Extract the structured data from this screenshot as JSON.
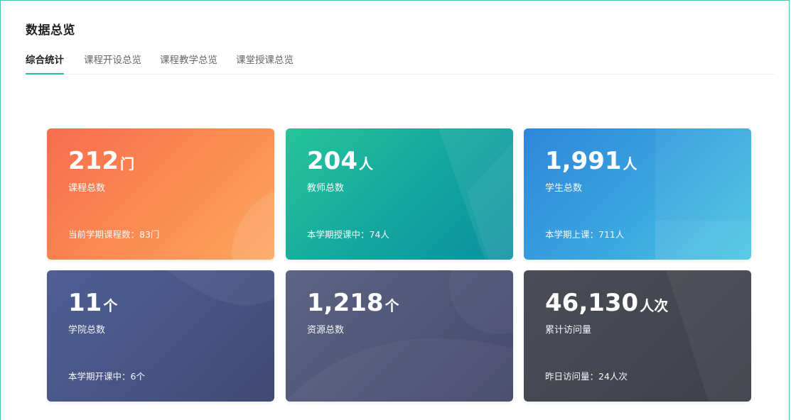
{
  "header": {
    "title": "数据总览"
  },
  "tabs": [
    {
      "label": "综合统计",
      "active": true
    },
    {
      "label": "课程开设总览",
      "active": false
    },
    {
      "label": "课程教学总览",
      "active": false
    },
    {
      "label": "课堂授课总览",
      "active": false
    }
  ],
  "accent_color": "#2bb79b",
  "cards": [
    {
      "value": "212",
      "unit": "门",
      "label": "课程总数",
      "sub": "当前学期课程数：83门"
    },
    {
      "value": "204",
      "unit": "人",
      "label": "教师总数",
      "sub": "本学期授课中：74人"
    },
    {
      "value": "1,991",
      "unit": "人",
      "label": "学生总数",
      "sub": "本学期上课：711人"
    },
    {
      "value": "11",
      "unit": "个",
      "label": "学院总数",
      "sub": "本学期开课中：6个"
    },
    {
      "value": "1,218",
      "unit": "个",
      "label": "资源总数",
      "sub": ""
    },
    {
      "value": "46,130",
      "unit": "人次",
      "label": "累计访问量",
      "sub": "昨日访问量：24人次"
    }
  ]
}
